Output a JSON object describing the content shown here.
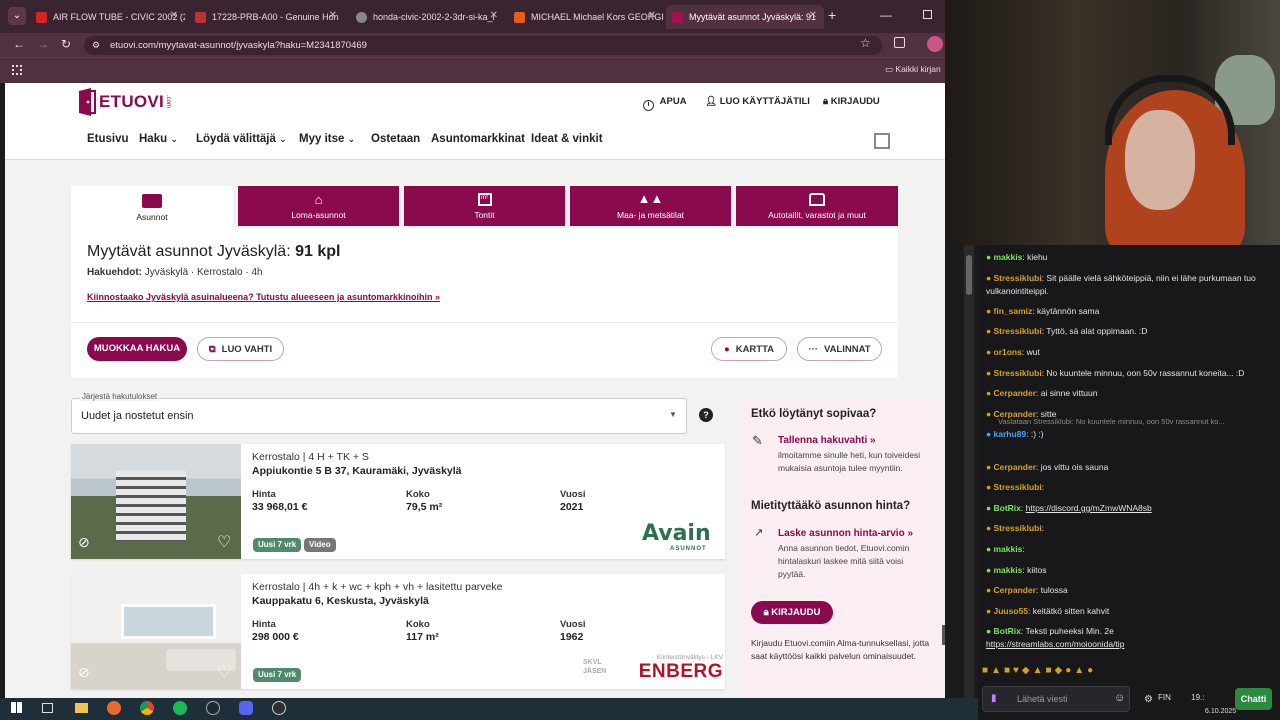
{
  "browser": {
    "tabs": [
      {
        "label": "AIR FLOW TUBE - CIVIC 2002 (2",
        "color": "#d22"
      },
      {
        "label": "17228-PRB-A00 - Genuine Hon",
        "color": "#b33"
      },
      {
        "label": "honda-civic-2002-2-3dr-si-ka_l",
        "color": "#888"
      },
      {
        "label": "MICHAEL Michael Kors GEORGI",
        "color": "#e85d1e"
      },
      {
        "label": "Myytävät asunnot Jyväskylä: 91",
        "color": "#a0134f"
      }
    ],
    "url": "etuovi.com/myytavat-asunnot/jyvaskyla?haku=M2341870469",
    "bookmarks_label": "Kaikki kirjan"
  },
  "site": {
    "logo": "ETUOVI",
    "logo_sub": ".com",
    "header_links": {
      "help": "APUA",
      "create_user": "LUO KÄYTTÄJÄTILI",
      "login": "KIRJAUDU"
    },
    "nav": [
      "Etusivu",
      "Haku",
      "Löydä välittäjä",
      "Myy itse",
      "Ostetaan",
      "Asuntomarkkinat",
      "Ideat & vinkit"
    ],
    "category_tabs": [
      "Asunnot",
      "Loma-asunnot",
      "Tontit",
      "Maa- ja metsätilat",
      "Autotallit, varastot ja muut"
    ],
    "title_prefix": "Myytävät asunnot Jyväskylä:",
    "title_count": "91 kpl",
    "criteria_label": "Hakuehdot:",
    "criteria_value": "Jyväskylä · Kerrostalo · 4h",
    "area_link": "Kiinnostaako Jyväskylä asuinalueena? Tutustu alueeseen ja asuntomarkkinoihin »",
    "buttons": {
      "edit": "MUOKKAA HAKUA",
      "watch": "LUO VAHTI",
      "map": "KARTTA",
      "options": "VALINNAT"
    },
    "sort": {
      "label": "Järjestä hakutulokset",
      "value": "Uudet ja nostetut ensin"
    },
    "listings": [
      {
        "type": "Kerrostalo | 4 H + TK + S",
        "address": "Appiukontie 5 B 37, Kauramäki, Jyväskylä",
        "price_label": "Hinta",
        "price": "33 968,01 €",
        "size_label": "Koko",
        "size": "79,5 m²",
        "year_label": "Vuosi",
        "year": "2021",
        "badges": [
          "Uusi 7 vrk",
          "Video"
        ],
        "agency": "Avain",
        "agency_sub": "ASUNNOT"
      },
      {
        "type": "Kerrostalo | 4h + k + wc + kph + vh + lasitettu parveke",
        "address": "Kauppakatu 6, Keskusta, Jyväskylä",
        "price_label": "Hinta",
        "price": "298 000 €",
        "size_label": "Koko",
        "size": "117 m²",
        "year_label": "Vuosi",
        "year": "1962",
        "badges": [
          "Uusi 7 vrk"
        ],
        "agency": "ENBERG",
        "agency_sub": "Kiinteistönvälitys - LKV",
        "agency_extra": "SKVL JÄSEN"
      }
    ],
    "sidebar": {
      "title1": "Etkö löytänyt sopivaa?",
      "link1": "Tallenna hakuvahti »",
      "text1": "ilmoitamme sinulle heti, kun toiveidesi mukaisia asuntoja tulee myyntiin.",
      "title2": "Mietityttääkö asunnon hinta?",
      "link2": "Laske asunnon hinta-arvio »",
      "text2": "Anna asunnon tiedot, Etuovi.comin hintalaskuri laskee mitä siitä voisi pyytää.",
      "login_button": "KIRJAUDU",
      "text3": "Kirjaudu Etuovi.comiin Alma-tunnuksellasi, jotta saat käyttöösi kaikki palvelun ominaisuudet."
    }
  },
  "chat": {
    "messages": [
      {
        "user": "makkis",
        "color": "#7ce35a",
        "text": "kiehu"
      },
      {
        "user": "Stressiklubi",
        "color": "#d4a21e",
        "text": "Sit päälle vielä sähköteippiä, niin ei lähe purkumaan tuo vulkanointiteippi."
      },
      {
        "user": "fin_samiz",
        "color": "#d4a21e",
        "text": "käytännön sama"
      },
      {
        "user": "Stressiklubi",
        "color": "#d4a21e",
        "text": "Tyttö, sä alat oppimaan. :D"
      },
      {
        "user": "or1ons",
        "color": "#d4a21e",
        "text": "wut"
      },
      {
        "user": "Stressiklubi",
        "color": "#d4a21e",
        "text": "No kuuntele minnuu, oon 50v rassannut koneita... :D"
      },
      {
        "user": "Cerpander",
        "color": "#d4a21e",
        "text": "ai sinne vittuun"
      },
      {
        "user": "Cerpander",
        "color": "#d4a21e",
        "text": "sitte"
      },
      {
        "user": "karhu89",
        "color": "#4aa3ff",
        "text": ":) :)",
        "reply": "Vastataan Stressiklubi: No kuuntele minnuu, oon 50v rassannut ko..."
      },
      {
        "user": "Cerpander",
        "color": "#d4a21e",
        "text": "jos vittu ois sauna"
      },
      {
        "user": "Stressiklubi",
        "color": "#d4a21e",
        "text": ""
      },
      {
        "user": "BotRix",
        "color": "#7ce35a",
        "text": "https://discord.gg/mZmwWNA8sb"
      },
      {
        "user": "Stressiklubi",
        "color": "#d4a21e",
        "text": ""
      },
      {
        "user": "makkis",
        "color": "#7ce35a",
        "text": ""
      },
      {
        "user": "makkis",
        "color": "#7ce35a",
        "text": "kiitos"
      },
      {
        "user": "Cerpander",
        "color": "#d4a21e",
        "text": "tulossa"
      },
      {
        "user": "Juuso55",
        "color": "#d4a21e",
        "text": "keitätkö sitten kahvit"
      },
      {
        "user": "BotRix",
        "color": "#7ce35a",
        "text": "Teksti puheeksi Min. 2e"
      },
      {
        "user": "",
        "color": "#7ce35a",
        "text": "https://streamlabs.com/moioonida/tip"
      }
    ],
    "input_placeholder": "Lähetä viesti",
    "chat_button": "Chatti"
  },
  "taskbar": {
    "lang": "FIN",
    "time": "19.:",
    "date": "6.10.2025"
  },
  "colors": {
    "brand": "#8a0a4d",
    "badge": "#4f8a6e",
    "chat_bg": "#18181b"
  }
}
